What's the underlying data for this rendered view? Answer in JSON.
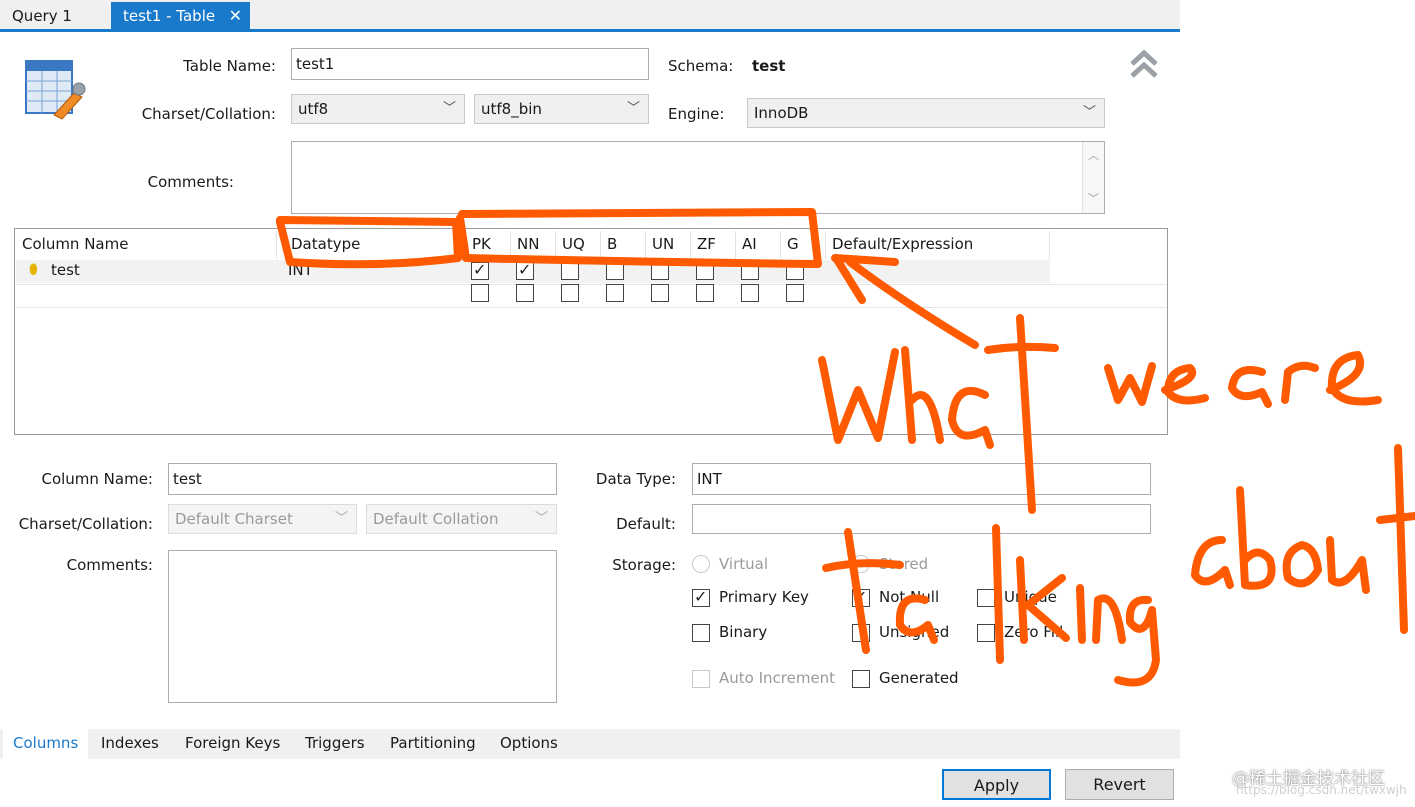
{
  "tabs": [
    {
      "label": "Query 1"
    },
    {
      "label": "test1 - Table"
    }
  ],
  "header": {
    "table_name_label": "Table Name:",
    "table_name_value": "test1",
    "schema_label": "Schema:",
    "schema_value": "test",
    "charset_label": "Charset/Collation:",
    "charset_value": "utf8",
    "collation_value": "utf8_bin",
    "engine_label": "Engine:",
    "engine_value": "InnoDB",
    "comments_label": "Comments:"
  },
  "grid": {
    "columns": [
      "Column Name",
      "Datatype",
      "PK",
      "NN",
      "UQ",
      "B",
      "UN",
      "ZF",
      "AI",
      "G",
      "Default/Expression"
    ],
    "rows": [
      {
        "name": "test",
        "datatype": "INT",
        "flags": [
          true,
          true,
          false,
          false,
          false,
          false,
          false,
          false
        ]
      }
    ]
  },
  "details": {
    "column_name_label": "Column Name:",
    "column_name_value": "test",
    "data_type_label": "Data Type:",
    "data_type_value": "INT",
    "charset_label": "Charset/Collation:",
    "charset_placeholder": "Default Charset",
    "collation_placeholder": "Default Collation",
    "default_label": "Default:",
    "comments_label": "Comments:",
    "storage_label": "Storage:",
    "virtual_label": "Virtual",
    "stored_label": "Stored",
    "checkboxes": {
      "primary_key": {
        "label": "Primary Key",
        "checked": true
      },
      "not_null": {
        "label": "Not Null",
        "checked": true
      },
      "unique": {
        "label": "Unique",
        "checked": false
      },
      "binary": {
        "label": "Binary",
        "checked": false
      },
      "unsigned": {
        "label": "Unsigned",
        "checked": false
      },
      "zero_fill": {
        "label": "Zero Fill",
        "checked": false
      },
      "auto_increment": {
        "label": "Auto Increment",
        "checked": false
      },
      "generated": {
        "label": "Generated",
        "checked": false
      }
    }
  },
  "bottom_tabs": [
    "Columns",
    "Indexes",
    "Foreign Keys",
    "Triggers",
    "Partitioning",
    "Options"
  ],
  "buttons": {
    "apply": "Apply",
    "revert": "Revert"
  },
  "watermark": "@稀土掘金技术社区",
  "watermark_url": "https://blog.csdn.net/twxwjh",
  "colors": {
    "accent": "#1979ca",
    "annotation": "#ff5a00"
  }
}
